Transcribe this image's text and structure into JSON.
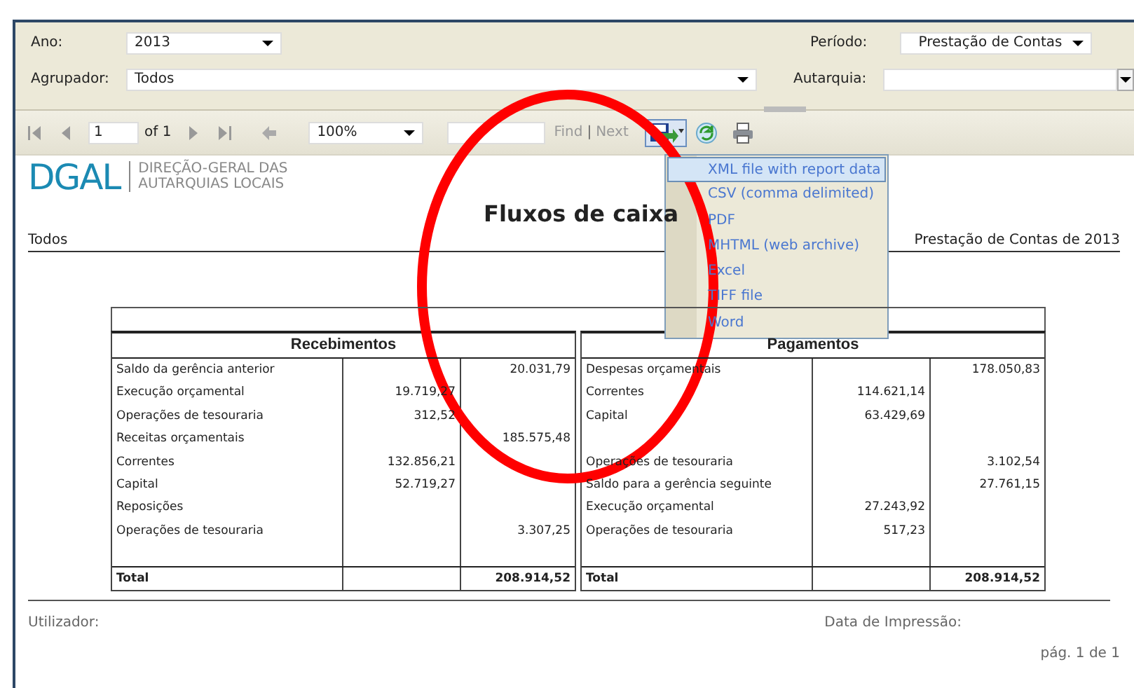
{
  "parameters": [
    {
      "label": "Ano:",
      "value": "2013"
    },
    {
      "label": "Período:",
      "value": "Prestação de Contas"
    },
    {
      "label": "Agrupador:",
      "value": "Todos"
    },
    {
      "label": "Autarquia:"
    }
  ],
  "toolbar": {
    "page_number": "1",
    "page_count": "of 1",
    "zoom": "100%",
    "find_label": "Find",
    "separator": "|",
    "next_label": "Next"
  },
  "export_menu": {
    "items": [
      {
        "label": "XML file with report data",
        "selected": true
      },
      {
        "label": "CSV (comma delimited)",
        "selected": false
      },
      {
        "label": "PDF",
        "selected": false
      },
      {
        "label": "MHTML (web archive)",
        "selected": false
      },
      {
        "label": "Excel",
        "selected": false
      },
      {
        "label": "TIFF file",
        "selected": false
      },
      {
        "label": "Word",
        "selected": false
      }
    ]
  },
  "report": {
    "logo": {
      "mark": "DGAL",
      "name_lines": [
        "DIREÇÃO-GERAL DAS",
        "AUTARQUIAS LOCAIS"
      ]
    },
    "title": "Fluxos de caixa",
    "group": "Todos",
    "period": "Prestação de Contas de 2013",
    "tables": [
      {
        "heading": "Recebimentos",
        "rows": [
          {
            "kind": "line",
            "label": "Saldo da gerência anterior",
            "col_3": "20.031,79"
          },
          {
            "kind": "line",
            "label": "Execução orçamental",
            "col_2": "19.719,27"
          },
          {
            "kind": "line",
            "label": "Operações de tesouraria",
            "col_2": "312,52"
          },
          {
            "kind": "line",
            "label": "Receitas orçamentais",
            "col_3": "185.575,48"
          },
          {
            "kind": "line",
            "label": "Correntes",
            "col_2": "132.856,21"
          },
          {
            "kind": "line",
            "label": "Capital",
            "col_2": "52.719,27"
          },
          {
            "kind": "line",
            "label": "Reposições"
          },
          {
            "kind": "line",
            "label": "Operações de tesouraria",
            "col_3": "3.307,25"
          },
          {
            "kind": "blank"
          },
          {
            "kind": "total",
            "label": "Total",
            "col_3": "208.914,52"
          }
        ]
      },
      {
        "heading": "Pagamentos",
        "rows": [
          {
            "kind": "line",
            "label": "Despesas orçamentais",
            "col_3": "178.050,83"
          },
          {
            "kind": "line",
            "label": "Correntes",
            "col_2": "114.621,14"
          },
          {
            "kind": "line",
            "label": "Capital",
            "col_2": "63.429,69"
          },
          {
            "kind": "blank"
          },
          {
            "kind": "line",
            "label": "Operações de tesouraria",
            "col_3": "3.102,54"
          },
          {
            "kind": "line",
            "label": "Saldo para a gerência seguinte",
            "col_3": "27.761,15"
          },
          {
            "kind": "line",
            "label": "Execução orçamental",
            "col_2": "27.243,92"
          },
          {
            "kind": "line",
            "label": "Operações de tesouraria",
            "col_2": "517,23"
          },
          {
            "kind": "blank"
          },
          {
            "kind": "total",
            "label": "Total",
            "col_3": "208.914,52"
          }
        ]
      }
    ]
  },
  "footer": {
    "user_label": "Utilizador:",
    "print_date_label": "Data de Impressão:",
    "page": "pág. 1 de 1"
  }
}
